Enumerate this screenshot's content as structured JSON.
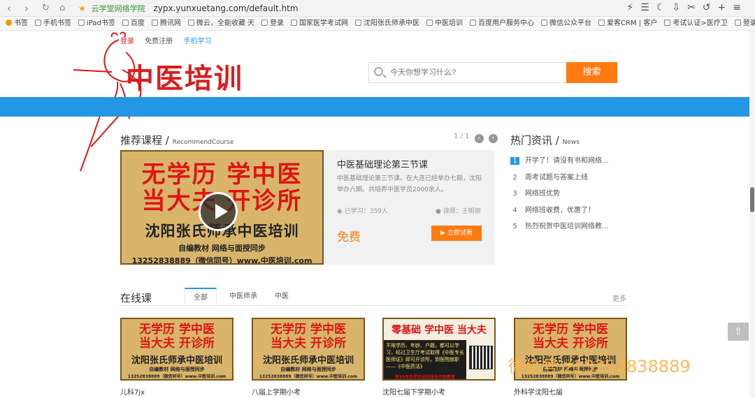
{
  "browser": {
    "site_name": "云学堂网络学院",
    "url": "zypx.yunxuetang.com/default.htm",
    "bookmarks": [
      "书签",
      "手机书签",
      "iPad书签",
      "百度",
      "腾讯网",
      "微云，全能收藏 天",
      "登录",
      "国家医学考试网",
      "沈阳张氏师承中医",
      "中医培训",
      "百度用户服务中心",
      "微信公众平台",
      "爱客CRM | 客户",
      "考试认证>医疗卫",
      "登录 - 今"
    ]
  },
  "header": {
    "login": "登录",
    "register": "免费注册",
    "mobile": "手机学习",
    "logo": "中医培训",
    "search_placeholder": "今天你想学习什么?",
    "search_button": "搜索"
  },
  "recommend": {
    "title": "推荐课程",
    "title_en": "RecommendCourse",
    "pager": "1 / 1",
    "banner": {
      "line1": "无学历  学中医",
      "line2": "当大夫  开诊所",
      "line3": "沈阳张氏师承中医培训",
      "line4": "自编教材    网络与面授同步",
      "line5": "13252838889（微信同号）www.中医培训.com"
    },
    "course_title": "中医基础理论第三节课",
    "course_desc": "中医基础理论第三节课。在大连已经举办七期，沈阳举办六期。共培养中医学员2000余人。",
    "studied": "已学习：359人",
    "teacher": "讲师：王明丽",
    "price": "免费",
    "trial_button": "立即试看"
  },
  "news": {
    "title": "热门资讯",
    "title_en": "News",
    "items": [
      {
        "n": "1",
        "text": "开学了！请没有书和网络..."
      },
      {
        "n": "2",
        "text": "周考试题与答案上线"
      },
      {
        "n": "3",
        "text": "网络班优势"
      },
      {
        "n": "4",
        "text": "网络班收费，优惠了！"
      },
      {
        "n": "5",
        "text": "热烈祝贺中医培训网络教..."
      }
    ]
  },
  "online": {
    "title": "在线课",
    "tabs": [
      "全部",
      "中医师承",
      "中医"
    ],
    "more": "更多",
    "cards": [
      {
        "title": "儿科7jx",
        "l1": "无学历  学中医",
        "l2": "当大夫  开诊所",
        "l3": "沈阳张氏师承中医培训",
        "l4": "自编教材    网络与面授同步",
        "l5": "13252838889（微信同号）www.中医培训.com"
      },
      {
        "title": "八届上学期小考",
        "l1": "无学历  学中医",
        "l2": "当大夫  开诊所",
        "l3": "沈阳张氏师承中医培训",
        "l4": "自编教材    网络与面授同步",
        "l5": "13252838889（微信同号）www.中医培训.com"
      },
      {
        "title": "沈阳七届下学期小考",
        "l1": "零基础 学中医 当大夫",
        "dark": "不限学历、年龄、户籍，都可以学习，经过卫生厅考试取得《中医专长医师证》即可开诊所，到医院就职——《中医药法》",
        "l5": "有35年办学历史的张氏中医教育"
      },
      {
        "title": "外科学沈阳七届",
        "l1": "无学历  学中医",
        "l2": "当大夫  开诊所",
        "l3": "沈阳张氏师承中医培训",
        "l4": "自编教材    网络与面授同步",
        "l5": "13252838889（微信同号）www.中医培训.com"
      }
    ]
  },
  "watermark": "微信号:z13252838889",
  "colors": {
    "accent_blue": "#2396e4",
    "accent_orange": "#ff7a11",
    "logo_red": "#d81e1e"
  }
}
